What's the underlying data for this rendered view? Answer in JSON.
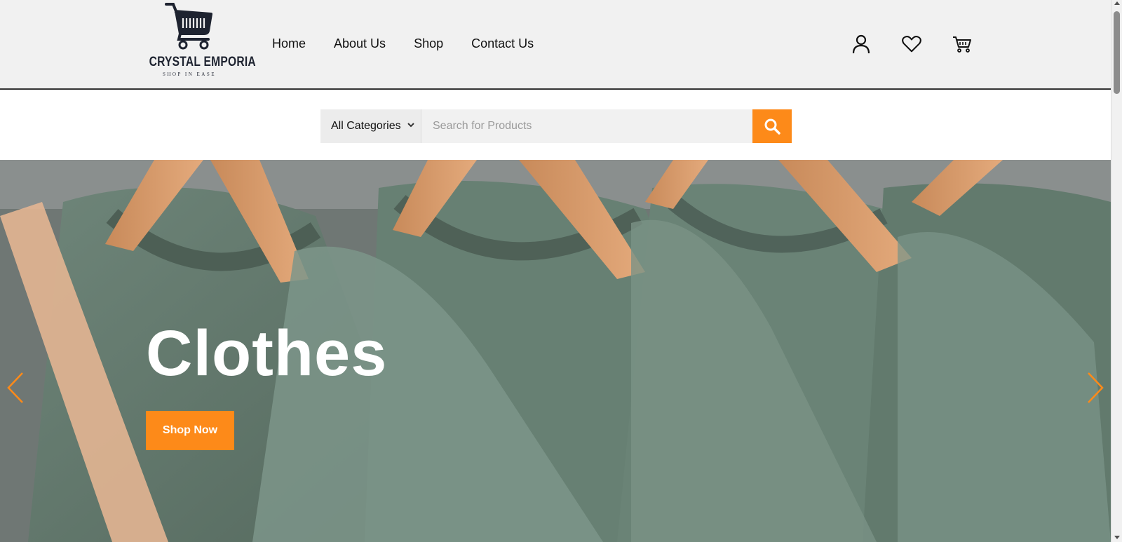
{
  "brand": {
    "name": "CRYSTAL EMPORIA",
    "tagline": "SHOP IN EASE"
  },
  "nav": {
    "items": [
      {
        "label": "Home"
      },
      {
        "label": "About Us"
      },
      {
        "label": "Shop"
      },
      {
        "label": "Contact Us"
      }
    ]
  },
  "header_icons": [
    "user-icon",
    "heart-icon",
    "cart-icon"
  ],
  "search": {
    "category_selected": "All Categories",
    "placeholder": "Search for Products",
    "button_icon": "search-icon"
  },
  "hero": {
    "title": "Clothes",
    "cta_label": "Shop Now",
    "prev_icon": "chevron-left-icon",
    "next_icon": "chevron-right-icon"
  },
  "colors": {
    "accent": "#fd8a19",
    "header_bg": "#f1f1f1",
    "text_dark": "#111111"
  }
}
